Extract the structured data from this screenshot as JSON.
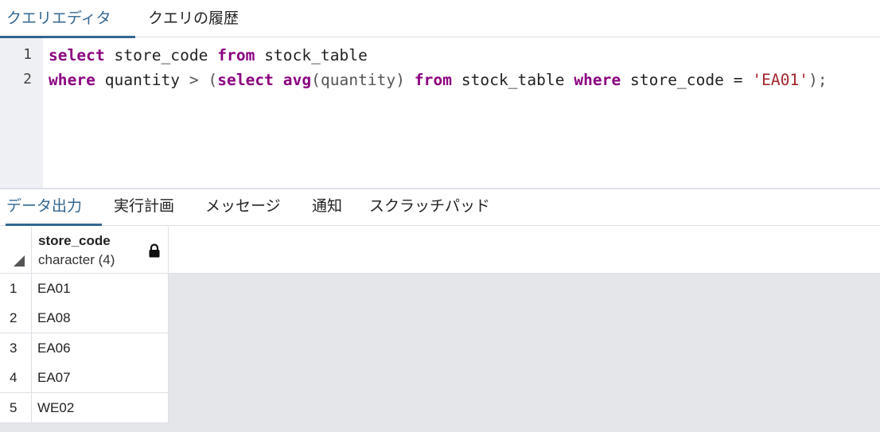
{
  "top_tabs": [
    {
      "label": "クエリエディタ",
      "active": true
    },
    {
      "label": "クエリの履歴",
      "active": false
    }
  ],
  "editor": {
    "line_numbers": [
      "1",
      "2"
    ],
    "lines": [
      [
        {
          "t": "select",
          "c": "kw"
        },
        {
          "t": " store_code ",
          "c": ""
        },
        {
          "t": "from",
          "c": "kw"
        },
        {
          "t": " stock_table",
          "c": ""
        }
      ],
      [
        {
          "t": "where",
          "c": "kw"
        },
        {
          "t": " quantity ",
          "c": ""
        },
        {
          "t": "> (",
          "c": "pun"
        },
        {
          "t": "select",
          "c": "kw"
        },
        {
          "t": " ",
          "c": ""
        },
        {
          "t": "avg",
          "c": "kw"
        },
        {
          "t": "(quantity) ",
          "c": "pun"
        },
        {
          "t": "from",
          "c": "kw"
        },
        {
          "t": " stock_table ",
          "c": ""
        },
        {
          "t": "where",
          "c": "kw"
        },
        {
          "t": " store_code = ",
          "c": ""
        },
        {
          "t": "'EA01'",
          "c": "str"
        },
        {
          "t": ");",
          "c": "pun"
        }
      ]
    ]
  },
  "bottom_tabs": [
    {
      "label": "データ出力",
      "active": true
    },
    {
      "label": "実行計画",
      "active": false
    },
    {
      "label": "メッセージ",
      "active": false
    },
    {
      "label": "通知",
      "active": false
    },
    {
      "label": "スクラッチパッド",
      "active": false
    }
  ],
  "grid": {
    "column": {
      "name": "store_code",
      "type": "character (4)",
      "icon": "lock-icon"
    },
    "rows": [
      {
        "num": "1",
        "value": "EA01"
      },
      {
        "num": "2",
        "value": "EA08"
      },
      {
        "num": "3",
        "value": "EA06"
      },
      {
        "num": "4",
        "value": "EA07"
      },
      {
        "num": "5",
        "value": "WE02"
      }
    ]
  },
  "colors": {
    "accent": "#326690",
    "keyword": "#8b0080",
    "string": "#a3242a",
    "gutter": "#eef0f4",
    "grid_empty": "#e4e6ea"
  }
}
